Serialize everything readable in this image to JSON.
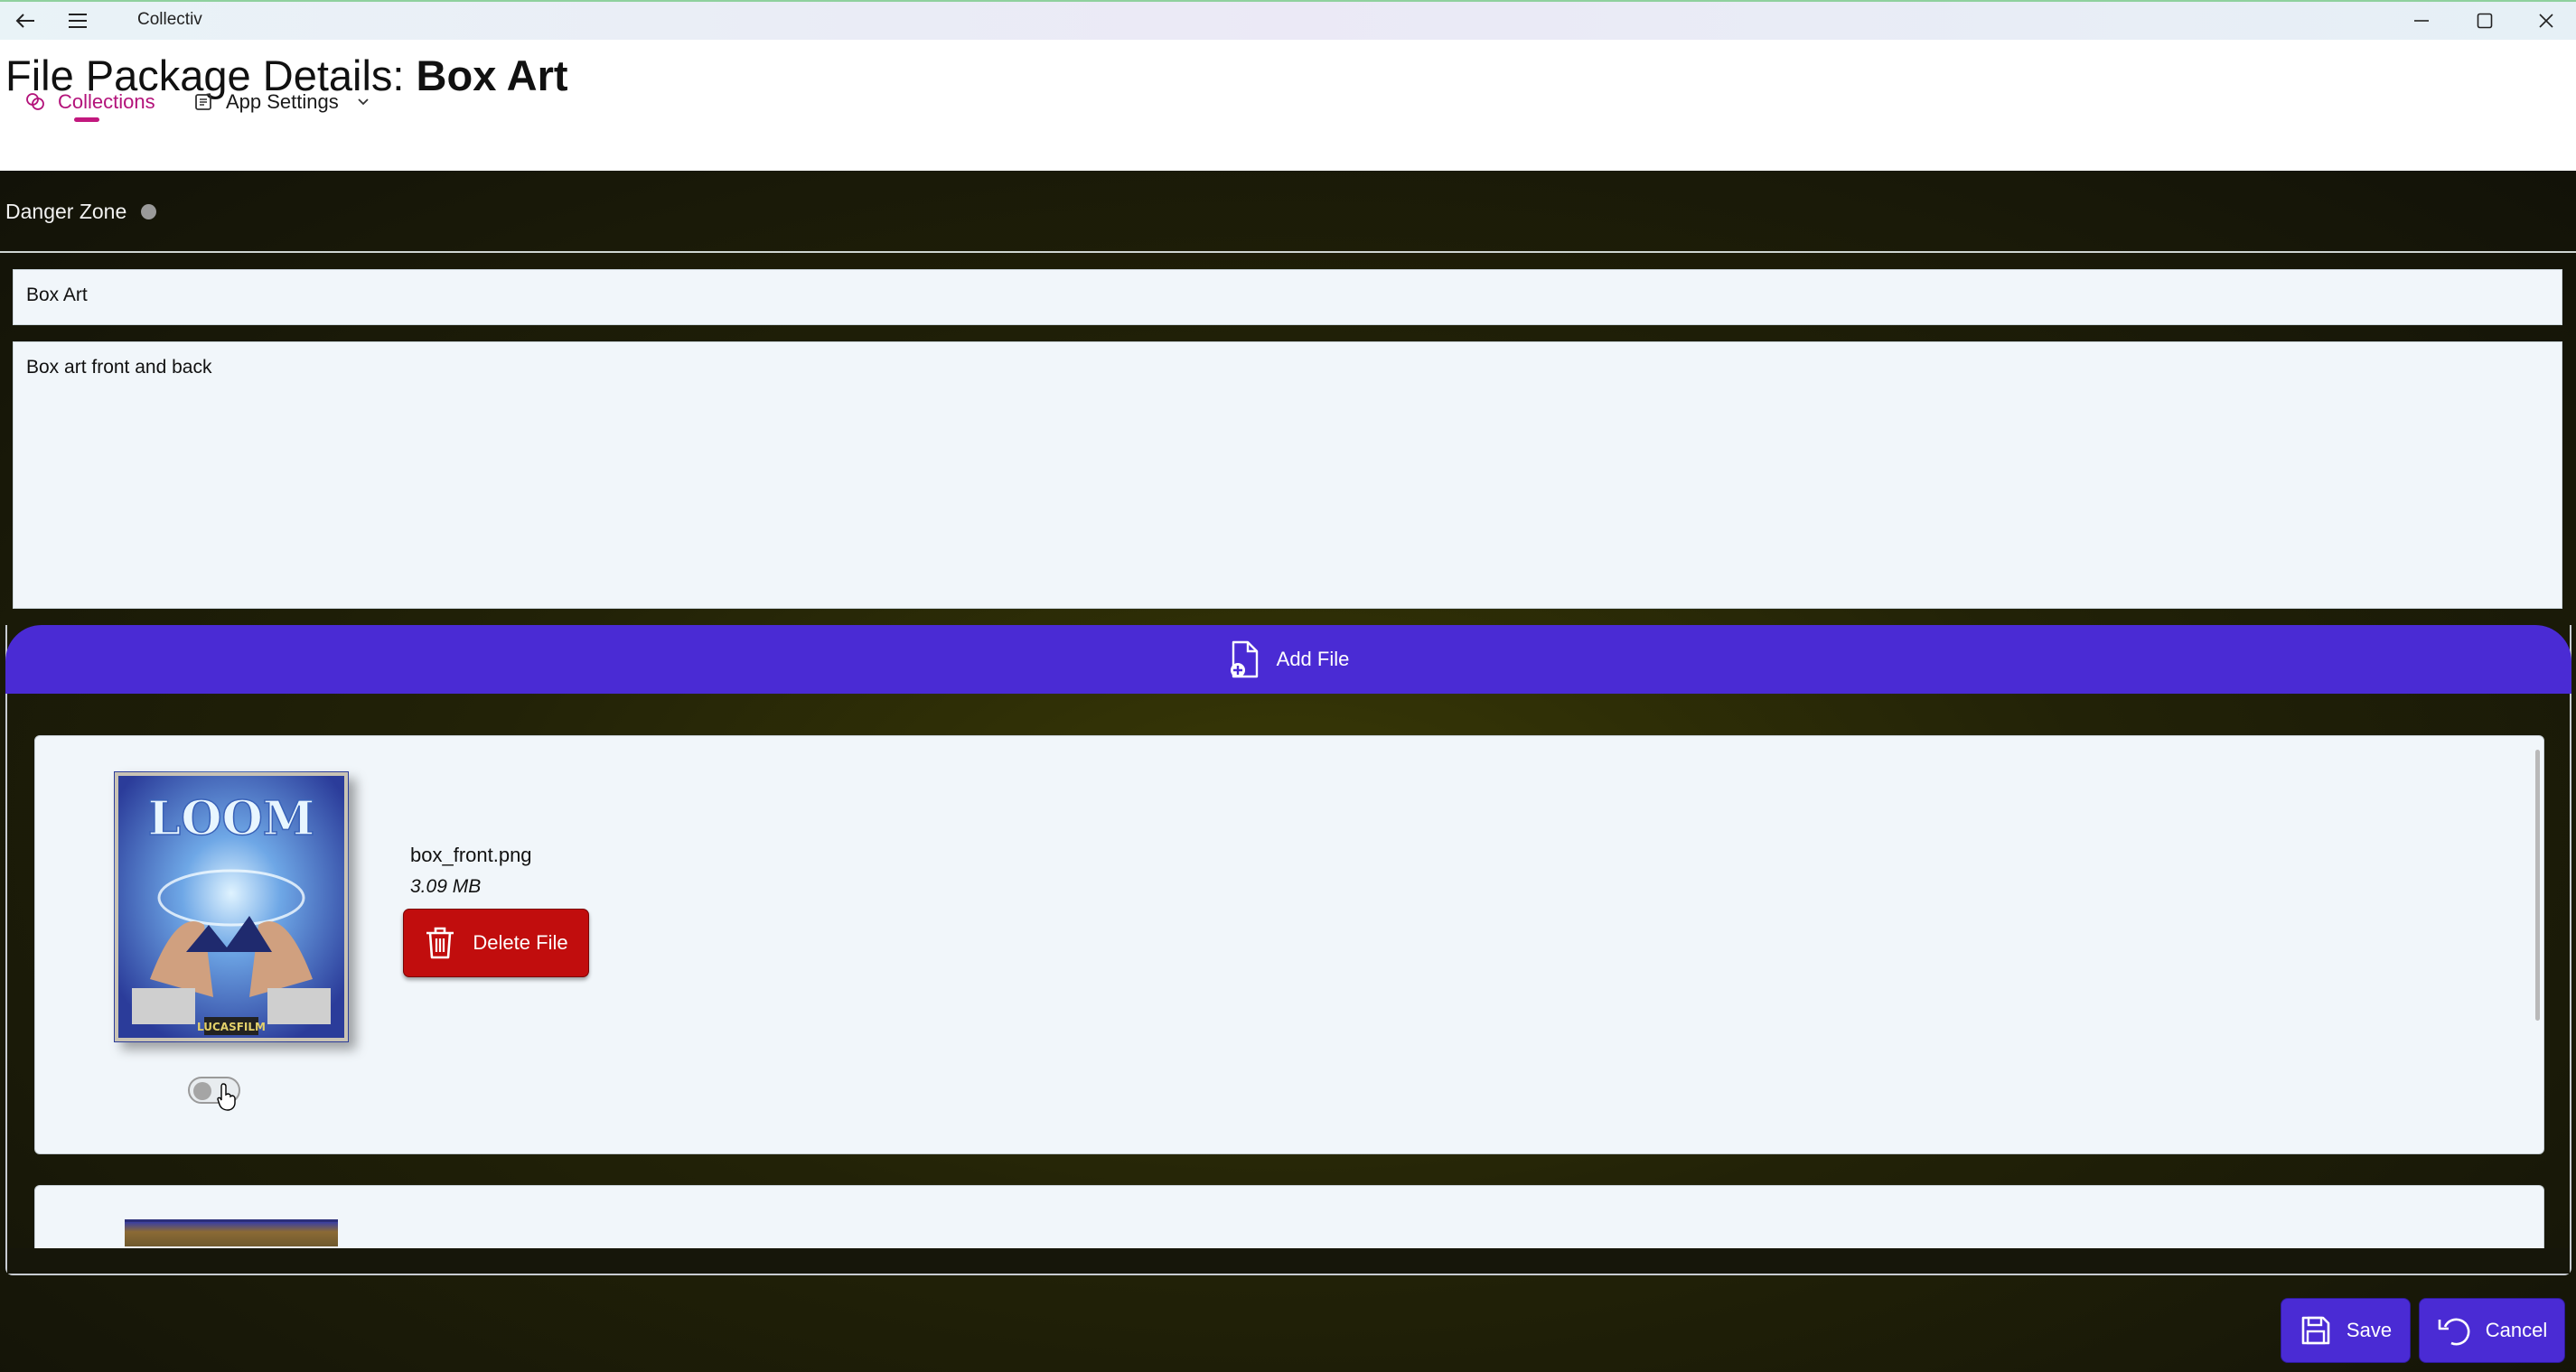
{
  "window": {
    "app_title": "Collectiv",
    "back_icon": "back-arrow-icon",
    "menu_icon": "hamburger-menu-icon",
    "minimize_icon": "minimize-icon",
    "maximize_icon": "maximize-icon",
    "close_icon": "close-icon"
  },
  "header": {
    "title_prefix": "File Package Details: ",
    "title_name": "Box Art"
  },
  "nav": {
    "items": [
      {
        "label": "Collections",
        "icon": "collections-icon",
        "active": true
      },
      {
        "label": "App Settings",
        "icon": "settings-icon",
        "has_dropdown": true
      }
    ],
    "accent_color": "#c2187e"
  },
  "danger_zone": {
    "label": "Danger Zone"
  },
  "form": {
    "name_value": "Box Art",
    "description_value": "Box art front and back"
  },
  "files": {
    "add_file_label": "Add File",
    "add_file_icon": "add-file-icon",
    "items": [
      {
        "file_name": "box_front.png",
        "file_size": "3.09 MB",
        "delete_label": "Delete File",
        "delete_icon": "trash-icon"
      }
    ]
  },
  "actions": {
    "save_label": "Save",
    "save_icon": "floppy-disk-icon",
    "cancel_label": "Cancel",
    "cancel_icon": "undo-arrow-icon"
  },
  "colors": {
    "primary": "#4a2bd4",
    "danger": "#c10d0d",
    "field_bg": "#f1f6fa"
  }
}
